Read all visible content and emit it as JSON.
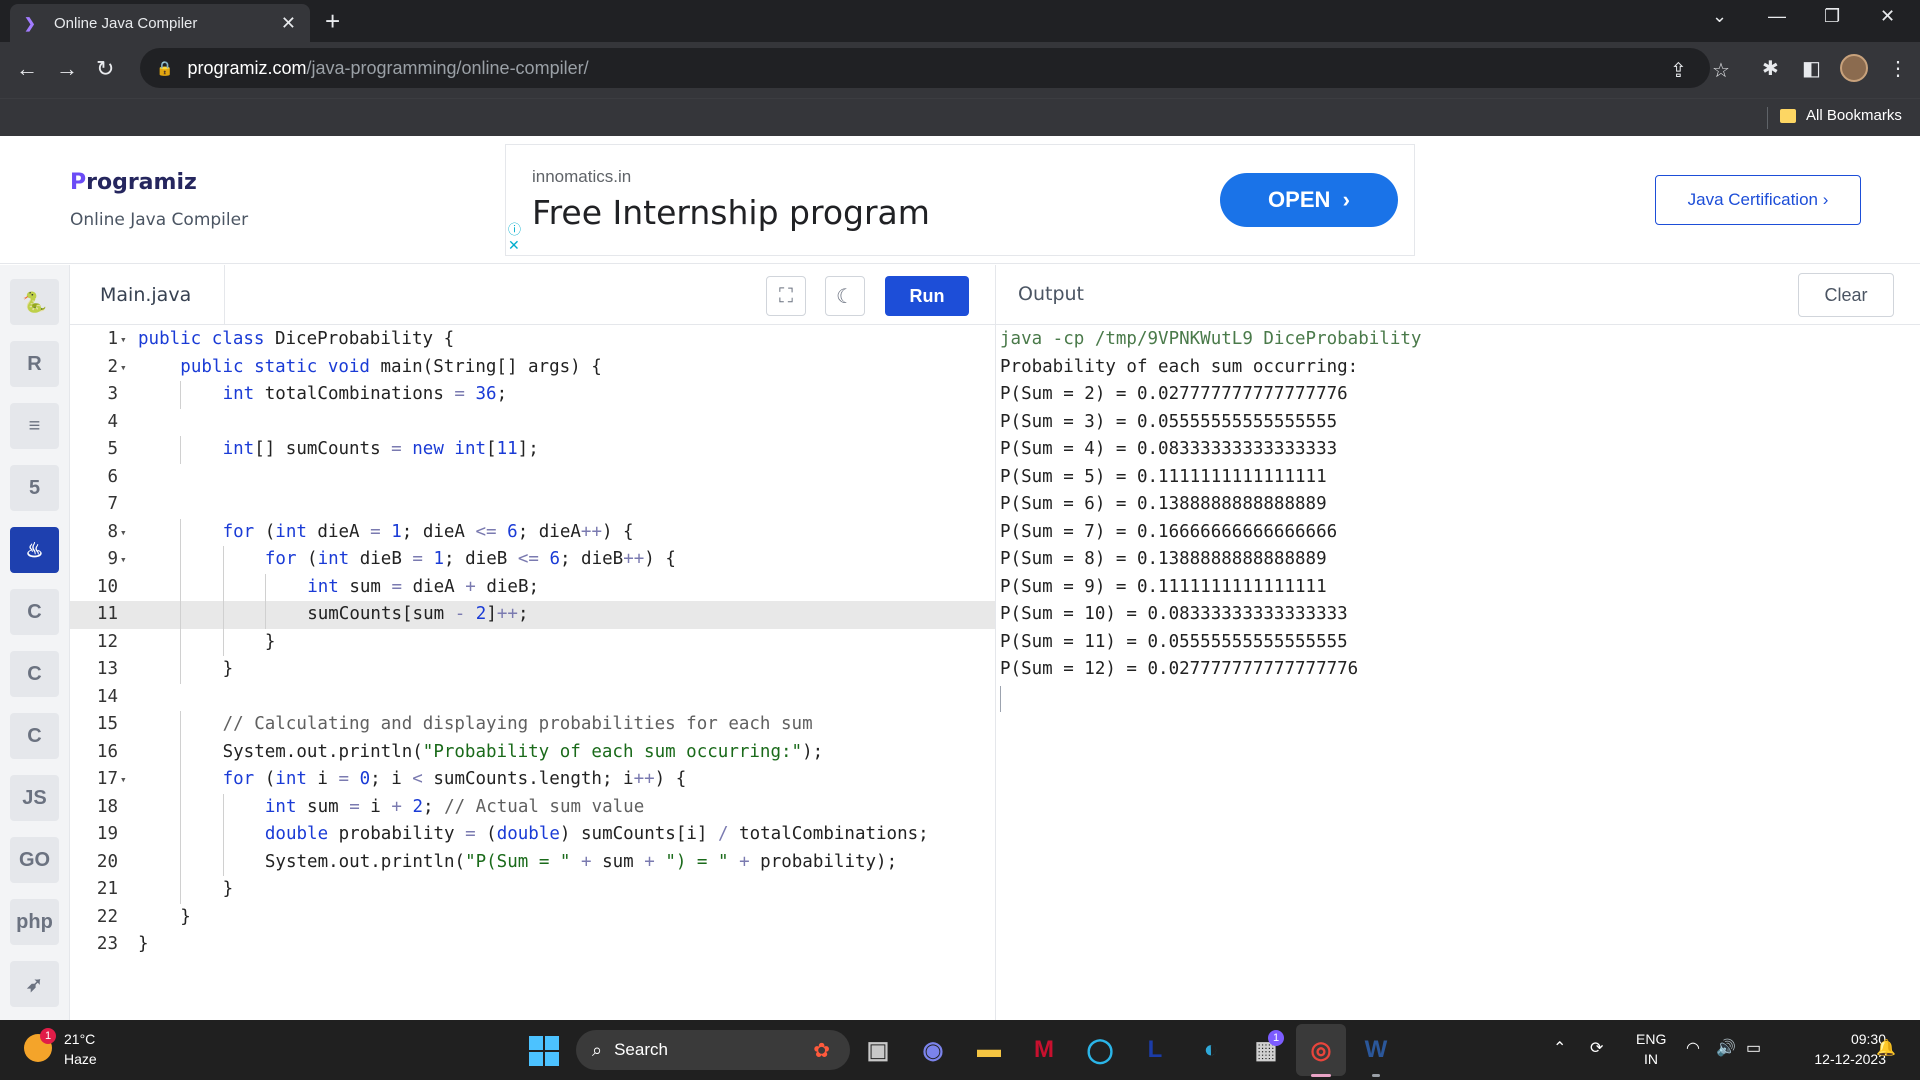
{
  "browser": {
    "tab_title": "Online Java Compiler",
    "new_tab_icon": "plus-icon",
    "url_host": "programiz.com",
    "url_path": "/java-programming/online-compiler/",
    "bookmarks_label": "All Bookmarks"
  },
  "header": {
    "logo_text": "rogramiz",
    "logo_initial": "P",
    "subtitle": "Online Java Compiler",
    "ad_domain": "innomatics.in",
    "ad_title": "Free Internship program",
    "ad_button": "OPEN",
    "cert_button": "Java Certification ›"
  },
  "rail": {
    "items": [
      {
        "icon": "python-icon",
        "glyph": "🐍"
      },
      {
        "icon": "r-icon",
        "glyph": "R"
      },
      {
        "icon": "sql-icon",
        "glyph": "≡"
      },
      {
        "icon": "html-icon",
        "glyph": "5"
      },
      {
        "icon": "java-icon",
        "glyph": "♨"
      },
      {
        "icon": "c-icon",
        "glyph": "C"
      },
      {
        "icon": "cpp-icon",
        "glyph": "C"
      },
      {
        "icon": "csharp-icon",
        "glyph": "C"
      },
      {
        "icon": "js-icon",
        "glyph": "JS"
      },
      {
        "icon": "go-icon",
        "glyph": "GO"
      },
      {
        "icon": "php-icon",
        "glyph": "php"
      },
      {
        "icon": "swift-icon",
        "glyph": "➶"
      }
    ],
    "active_index": 4
  },
  "editor": {
    "file_name": "Main.java",
    "run_label": "Run",
    "highlighted_line": 11,
    "lines": [
      {
        "n": "1",
        "fold": true,
        "indent": 0,
        "html": "<span class='kw'>public</span> <span class='kw'>class</span> DiceProbability {"
      },
      {
        "n": "2",
        "fold": true,
        "indent": 1,
        "html": "<span class='kw'>public</span> <span class='kw'>static</span> <span class='kw'>void</span> main(String[] args) {"
      },
      {
        "n": "3",
        "fold": false,
        "indent": 2,
        "html": "<span class='ty'>int</span> totalCombinations <span class='op'>=</span> <span class='num'>36</span>;"
      },
      {
        "n": "4",
        "fold": false,
        "indent": 0,
        "html": ""
      },
      {
        "n": "5",
        "fold": false,
        "indent": 2,
        "html": "<span class='ty'>int</span>[] sumCounts <span class='op'>=</span> <span class='kw'>new</span> <span class='ty'>int</span>[<span class='num'>11</span>];"
      },
      {
        "n": "6",
        "fold": false,
        "indent": 0,
        "html": ""
      },
      {
        "n": "7",
        "fold": false,
        "indent": 0,
        "html": ""
      },
      {
        "n": "8",
        "fold": true,
        "indent": 2,
        "html": "<span class='kw'>for</span> (<span class='ty'>int</span> dieA <span class='op'>=</span> <span class='num'>1</span>; dieA <span class='op'>&lt;=</span> <span class='num'>6</span>; dieA<span class='op'>++</span>) {"
      },
      {
        "n": "9",
        "fold": true,
        "indent": 3,
        "html": "<span class='kw'>for</span> (<span class='ty'>int</span> dieB <span class='op'>=</span> <span class='num'>1</span>; dieB <span class='op'>&lt;=</span> <span class='num'>6</span>; dieB<span class='op'>++</span>) {"
      },
      {
        "n": "10",
        "fold": false,
        "indent": 4,
        "html": "<span class='ty'>int</span> sum <span class='op'>=</span> dieA <span class='op'>+</span> dieB;"
      },
      {
        "n": "11",
        "fold": false,
        "indent": 4,
        "html": "sumCounts[sum <span class='op'>-</span> <span class='num'>2</span>]<span class='op'>++</span>;"
      },
      {
        "n": "12",
        "fold": false,
        "indent": 3,
        "html": "}"
      },
      {
        "n": "13",
        "fold": false,
        "indent": 2,
        "html": "}"
      },
      {
        "n": "14",
        "fold": false,
        "indent": 0,
        "html": ""
      },
      {
        "n": "15",
        "fold": false,
        "indent": 2,
        "html": "<span class='cm'>// Calculating and displaying probabilities for each sum</span>"
      },
      {
        "n": "16",
        "fold": false,
        "indent": 2,
        "html": "System.out.println(<span class='str'>\"Probability of each sum occurring:\"</span>);"
      },
      {
        "n": "17",
        "fold": true,
        "indent": 2,
        "html": "<span class='kw'>for</span> (<span class='ty'>int</span> i <span class='op'>=</span> <span class='num'>0</span>; i <span class='op'>&lt;</span> sumCounts.length; i<span class='op'>++</span>) {"
      },
      {
        "n": "18",
        "fold": false,
        "indent": 3,
        "html": "<span class='ty'>int</span> sum <span class='op'>=</span> i <span class='op'>+</span> <span class='num'>2</span>; <span class='cm'>// Actual sum value</span>"
      },
      {
        "n": "19",
        "fold": false,
        "indent": 3,
        "html": "<span class='ty'>double</span> probability <span class='op'>=</span> (<span class='ty'>double</span>) sumCounts[i] <span class='op'>/</span> totalCombinations;"
      },
      {
        "n": "20",
        "fold": false,
        "indent": 3,
        "html": "System.out.println(<span class='str'>\"P(Sum = \"</span> <span class='op'>+</span> sum <span class='op'>+</span> <span class='str'>\") = \"</span> <span class='op'>+</span> probability);"
      },
      {
        "n": "21",
        "fold": false,
        "indent": 2,
        "html": "}"
      },
      {
        "n": "22",
        "fold": false,
        "indent": 1,
        "html": "}"
      },
      {
        "n": "23",
        "fold": false,
        "indent": 0,
        "html": "}"
      }
    ]
  },
  "output": {
    "title": "Output",
    "clear_label": "Clear",
    "command": "java -cp /tmp/9VPNKWutL9 DiceProbability",
    "lines": [
      "Probability of each sum occurring:",
      "P(Sum = 2) = 0.027777777777777776",
      "P(Sum = 3) = 0.05555555555555555",
      "P(Sum = 4) = 0.08333333333333333",
      "P(Sum = 5) = 0.1111111111111111",
      "P(Sum = 6) = 0.1388888888888889",
      "P(Sum = 7) = 0.16666666666666666",
      "P(Sum = 8) = 0.1388888888888889",
      "P(Sum = 9) = 0.1111111111111111",
      "P(Sum = 10) = 0.08333333333333333",
      "P(Sum = 11) = 0.05555555555555555",
      "P(Sum = 12) = 0.027777777777777776"
    ]
  },
  "taskbar": {
    "weather_badge": "1",
    "temperature": "21°C",
    "condition": "Haze",
    "search_placeholder": "Search",
    "apps": [
      {
        "name": "task-view",
        "glyph": "▣",
        "color": "#c8c8c8"
      },
      {
        "name": "meet-app",
        "glyph": "◉",
        "color": "#7b83eb"
      },
      {
        "name": "file-explorer",
        "glyph": "▬",
        "color": "#f5c542"
      },
      {
        "name": "mcafee-app",
        "glyph": "M",
        "color": "#c8102e"
      },
      {
        "name": "cortana-app",
        "glyph": "◯",
        "color": "#2bb5e8"
      },
      {
        "name": "l-app",
        "glyph": "L",
        "color": "#1b3ca8"
      },
      {
        "name": "edge-browser",
        "glyph": "◐",
        "color": "#2fa9d9"
      },
      {
        "name": "store-app",
        "glyph": "▦",
        "color": "#d0d0d0"
      },
      {
        "name": "chrome-browser",
        "glyph": "◎",
        "color": "#e8453c"
      },
      {
        "name": "word-app",
        "glyph": "W",
        "color": "#2b579a"
      }
    ],
    "store_badge": "1",
    "lang_line1": "ENG",
    "lang_line2": "IN",
    "time": "09:30",
    "date": "12-12-2023"
  }
}
